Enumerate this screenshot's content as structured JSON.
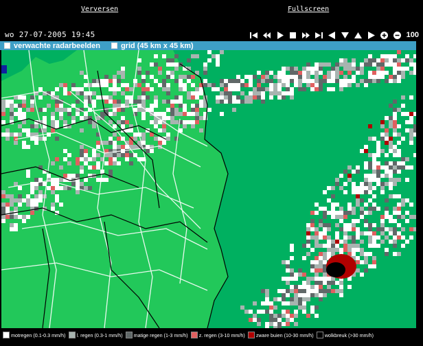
{
  "links": {
    "refresh": "Verversen",
    "fullscreen": "Fullscreen"
  },
  "timestamp": "wo 27-07-2005 19:45",
  "zoom": "100",
  "options": {
    "forecast": "verwachte radarbeelden",
    "grid": "grid (45 km x 45 km)"
  },
  "controls": [
    "skip-back-icon",
    "rewind-icon",
    "play-icon",
    "stop-icon",
    "fast-forward-icon",
    "skip-forward-icon",
    "pan-left-icon",
    "pan-down-icon",
    "pan-up-icon",
    "pan-right-icon",
    "zoom-in-icon",
    "zoom-out-icon"
  ],
  "colors": {
    "land": "#22c85a",
    "sea": "#00b060",
    "motregen": "#ffffff",
    "licht": "#a8b4b0",
    "matig": "#606868",
    "zwaar": "#e06060",
    "buien": "#b00000",
    "wolkbreuk": "#000000",
    "bar": "#3e9fc6"
  },
  "legend": [
    {
      "label": "motregen (0.1-0.3 mm/h)",
      "color": "#ffffff"
    },
    {
      "label": "l. regen (0.3-1 mm/h)",
      "color": "#a8b4b0"
    },
    {
      "label": "matige regen (1-3 mm/h)",
      "color": "#606868"
    },
    {
      "label": "z. regen (3-10 mm/h)",
      "color": "#e06060"
    },
    {
      "label": "zware buien (10-30 mm/h)",
      "color": "#b00000"
    },
    {
      "label": "wolkbreuk (>30 mm/h)",
      "color": "#000000"
    }
  ]
}
